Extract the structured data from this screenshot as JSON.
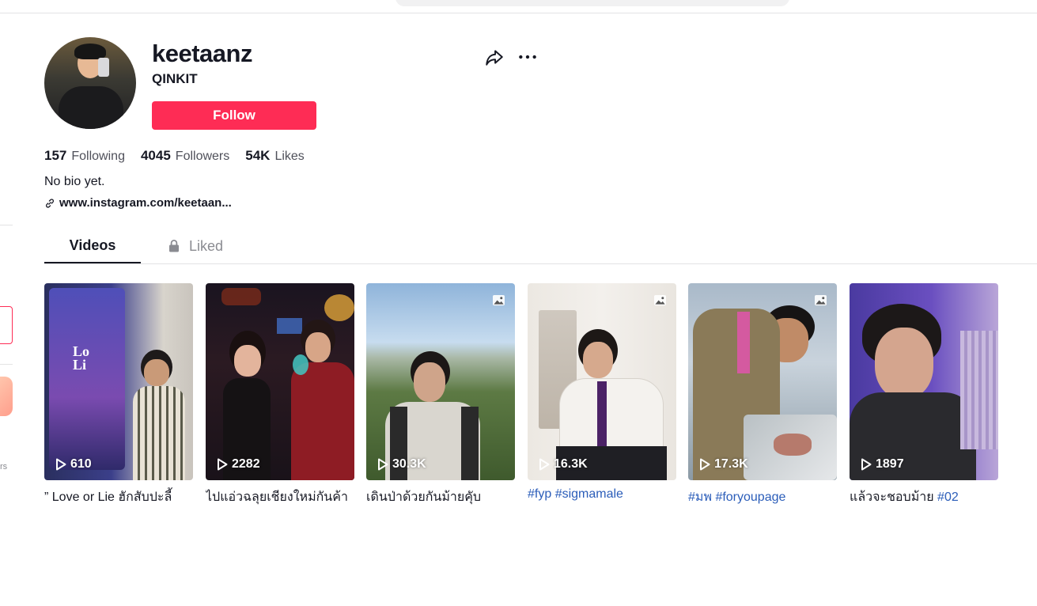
{
  "profile": {
    "username": "keetaanz",
    "nickname": "QINKIT",
    "follow_label": "Follow",
    "stats": [
      {
        "count": "157",
        "label": "Following"
      },
      {
        "count": "4045",
        "label": "Followers"
      },
      {
        "count": "54K",
        "label": "Likes"
      }
    ],
    "bio": "No bio yet.",
    "link": "www.instagram.com/keetaan..."
  },
  "sidebar": {
    "partial_text": "rs"
  },
  "tabs": [
    {
      "label": "Videos",
      "active": true
    },
    {
      "label": "Liked",
      "locked": true
    }
  ],
  "videos": [
    {
      "views": "610",
      "caption": "” Love or Lie ฮักสับปะลี้",
      "tags": "",
      "photo": false
    },
    {
      "views": "2282",
      "caption": "ไปแอ่วฉลุยเชียงใหม่กันค้า",
      "tags": "",
      "photo": false
    },
    {
      "views": "30.3K",
      "caption": "เดินป่าด้วยกันม้ายคุับ",
      "tags": "",
      "photo": true
    },
    {
      "views": "16.3K",
      "caption": "",
      "tags": "#fyp #sigmamale",
      "photo": true
    },
    {
      "views": "17.3K",
      "caption": "",
      "tags": "#มพ #foryoupage",
      "photo": true
    },
    {
      "views": "1897",
      "caption": "แล้วจะชอบม้าย ",
      "tags": "#02",
      "photo": false
    }
  ],
  "colors": {
    "accent": "#fe2c55",
    "hashtag": "#2b5db9",
    "text": "#161823",
    "muted": "#8a8b91"
  },
  "icons": [
    "share-icon",
    "more-icon",
    "link-icon",
    "lock-icon",
    "play-icon",
    "photo-icon"
  ]
}
